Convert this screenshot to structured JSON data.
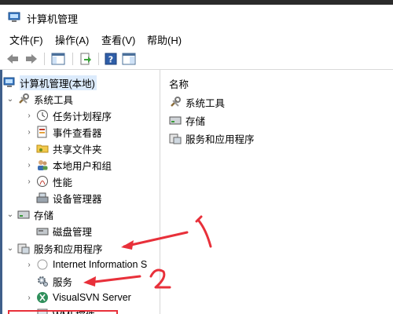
{
  "window": {
    "title": "计算机管理"
  },
  "menu": [
    "文件(F)",
    "操作(A)",
    "查看(V)",
    "帮助(H)"
  ],
  "toolbar": {
    "icons": [
      "back-arrow-icon",
      "forward-arrow-icon",
      "show-hide-tree-icon",
      "export-list-icon",
      "help-icon",
      "console-tree-icon"
    ]
  },
  "tree": {
    "root": "计算机管理(本地)",
    "system_tools": {
      "label": "系统工具",
      "children": [
        "任务计划程序",
        "事件查看器",
        "共享文件夹",
        "本地用户和组",
        "性能",
        "设备管理器"
      ]
    },
    "storage": {
      "label": "存储",
      "children": [
        "磁盘管理"
      ]
    },
    "services_apps": {
      "label": "服务和应用程序",
      "children": [
        "Internet Information S",
        "服务",
        "VisualSVN Server",
        "WMI 控件"
      ]
    }
  },
  "right": {
    "header": "名称",
    "items": [
      "系统工具",
      "存储",
      "服务和应用程序"
    ]
  },
  "annotations": {
    "arrow1_label": "1",
    "arrow2_label": "2"
  },
  "colors": {
    "annotation": "#e8303a",
    "selection": "#dcebfc"
  }
}
